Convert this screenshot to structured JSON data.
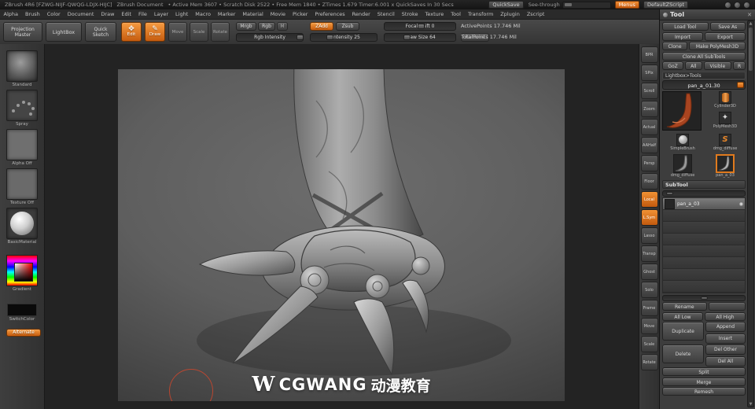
{
  "titlebar": {
    "app_title": "ZBrush 4R6 [FZWG-NIJF-QWQG-LDJX-HIJC]",
    "doc_title": "ZBrush Document",
    "stats": "• Active Mem 3607 • Scratch Disk 2522 • Free Mem 1840 • ZTimes 1.679 Timer:6.001 x QuickSaves In 30 Secs",
    "quicksave": "QuickSave",
    "seethrough": "See-through",
    "menus": "Menus",
    "zscript": "DefaultZScript"
  },
  "menubar": {
    "items": [
      "Alpha",
      "Brush",
      "Color",
      "Document",
      "Draw",
      "Edit",
      "File",
      "Layer",
      "Light",
      "Macro",
      "Marker",
      "Material",
      "Movie",
      "Picker",
      "Preferences",
      "Render",
      "Stencil",
      "Stroke",
      "Texture",
      "Tool",
      "Transform",
      "Zplugin",
      "Zscript"
    ]
  },
  "toolbar": {
    "projection_master": "Projection Master",
    "lightbox": "LightBox",
    "quick_sketch": "Quick Sketch",
    "edit": "Edit",
    "draw": "Draw",
    "move": "Move",
    "scale": "Scale",
    "rotate": "Rotate",
    "mrgb": "Mrgb",
    "rgb": "Rgb",
    "m": "M",
    "rgb_intensity": "Rgb Intensity",
    "zadd": "ZAdd",
    "zsub": "Zsub",
    "z_intensity": "Z Intensity 25",
    "focal_shift": "Focal Shift 0",
    "draw_size": "Draw Size 64",
    "rename": "Rename",
    "active_points": "ActivePoints 17.746 Mil",
    "total_points": "TotalPoints 17.746 Mil"
  },
  "left_shelf": {
    "brush": "Standard",
    "stroke": "Spray",
    "alpha": "Alpha Off",
    "texture": "Texture Off",
    "material": "BasicMaterial",
    "gradient": "Gradient",
    "switchcolor": "SwitchColor",
    "alternate": "Alternate"
  },
  "right_shelf": {
    "items": [
      {
        "label": "BPR"
      },
      {
        "label": "SPix"
      },
      {
        "label": "Scroll"
      },
      {
        "label": "Zoom"
      },
      {
        "label": "Actual"
      },
      {
        "label": "AAHalf"
      },
      {
        "label": "Persp"
      },
      {
        "label": "Floor"
      },
      {
        "label": "Local"
      },
      {
        "label": "L.Sym"
      },
      {
        "label": "Lasso"
      },
      {
        "label": "Transp"
      },
      {
        "label": "Ghost"
      },
      {
        "label": "Solo"
      },
      {
        "label": "Frame"
      },
      {
        "label": "Move"
      },
      {
        "label": "Scale"
      },
      {
        "label": "Rotate"
      }
    ]
  },
  "canvas": {
    "watermark_logo": "W",
    "watermark_brand": "CGWANG",
    "watermark_cn": "动漫教育"
  },
  "tool_panel": {
    "title": "Tool",
    "load_tool": "Load Tool",
    "save_as": "Save As",
    "import": "Import",
    "export": "Export",
    "clone": "Clone",
    "make_polymesh3d": "Make PolyMesh3D",
    "clone_all_subtools": "Clone All SubTools",
    "goz": "GoZ",
    "all": "All",
    "visible": "Visible",
    "r": "R",
    "lightbox_tools": "Lightbox>Tools",
    "tool_name": "pan_a_01.30",
    "thumbs": [
      {
        "label": "Cylinder3D"
      },
      {
        "label": "PolyMesh3D"
      },
      {
        "label": "SimpleBrush"
      },
      {
        "label": "dmg_diffuse"
      },
      {
        "label": "dmg_diffuse"
      },
      {
        "label": "pan_a_03"
      }
    ],
    "subtool": {
      "title": "SubTool",
      "selected_name": "pan_a_03",
      "rename": "Rename",
      "all_low": "All Low",
      "all_high": "All High",
      "duplicate": "Duplicate",
      "append": "Append",
      "insert": "Insert",
      "delete": "Delete",
      "del_other": "Del Other",
      "del_all": "Del All",
      "split": "Split",
      "merge": "Merge",
      "remesh": "Remesh"
    }
  },
  "colors": {
    "accent_orange": "#e06c1a",
    "panel_bg": "#3d3d3d",
    "canvas_mid": "#636363"
  }
}
